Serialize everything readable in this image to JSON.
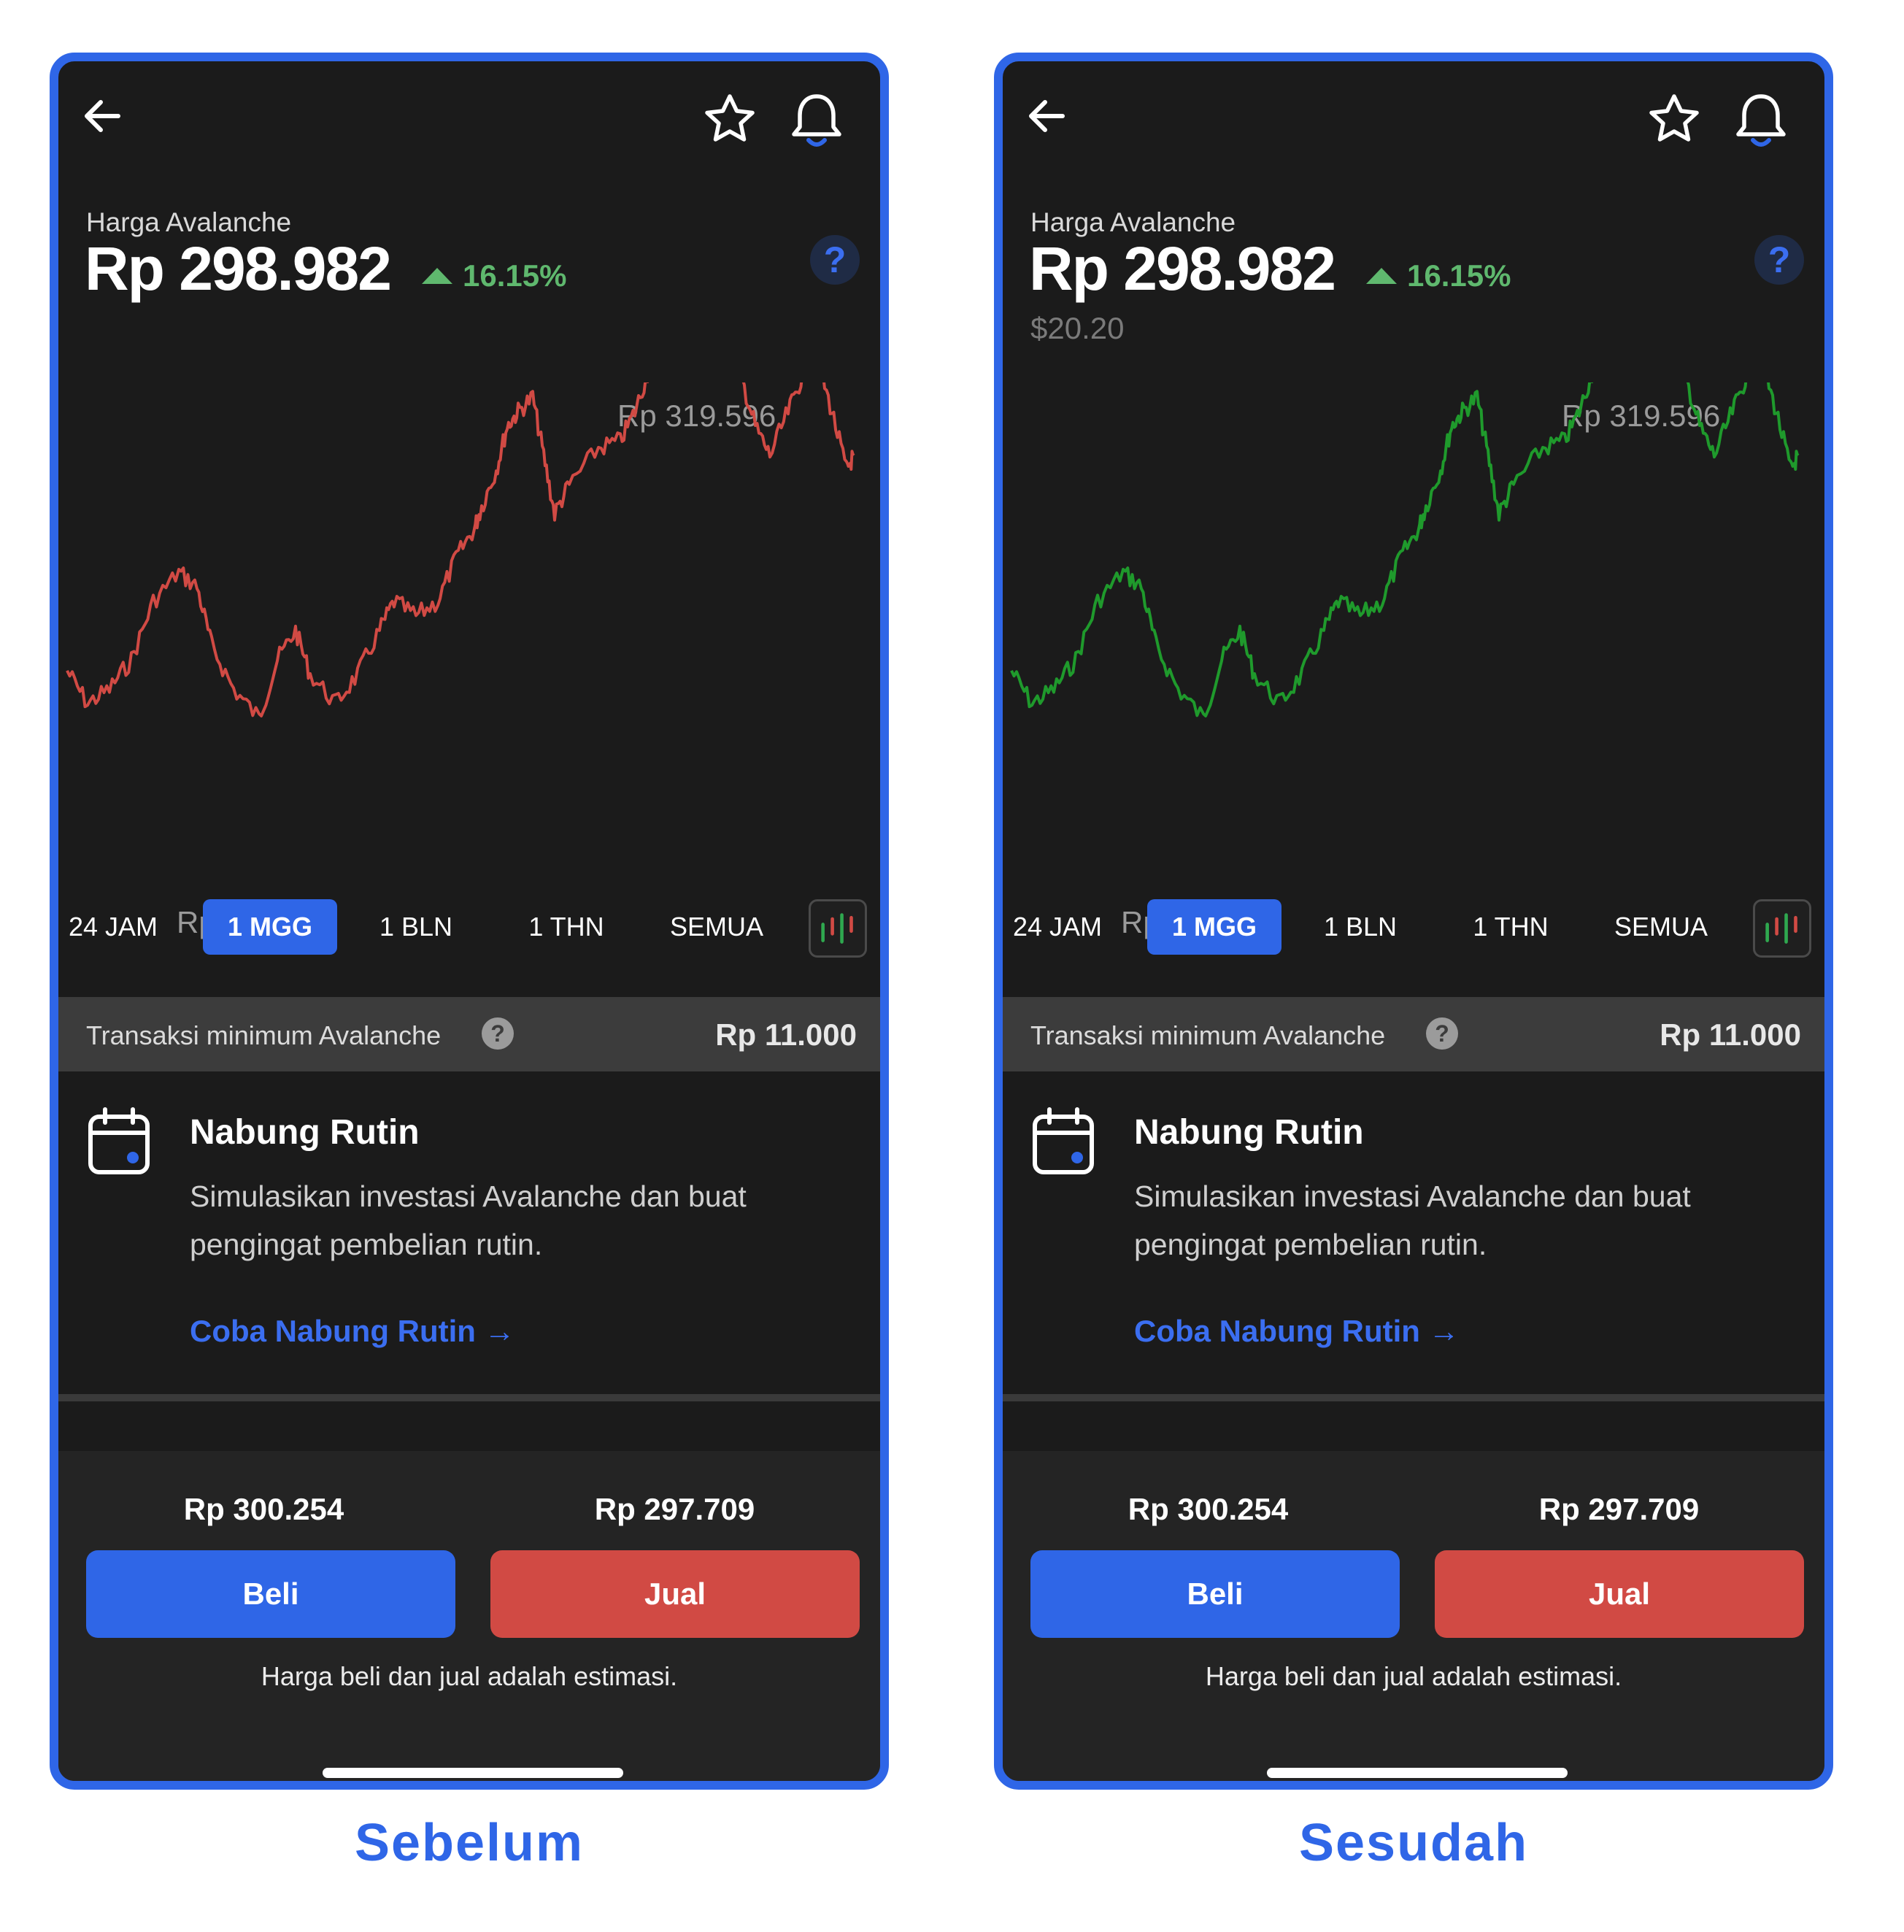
{
  "screens": [
    {
      "asset_label": "Harga Avalanche",
      "price": "Rp 298.982",
      "change": "16.15%",
      "usd_price": "",
      "help_symbol": "?",
      "chart_high": "Rp 319.596",
      "chart_low": "Rp 238.563",
      "line_color": "#d14a44",
      "tabs": [
        "24 JAM",
        "1 MGG",
        "1 BLN",
        "1 THN",
        "SEMUA"
      ],
      "active_tab": "1 MGG",
      "min_label": "Transaksi minimum Avalanche",
      "min_value": "Rp 11.000",
      "nabung_title": "Nabung Rutin",
      "nabung_desc": "Simulasikan investasi Avalanche dan buat pengingat pembelian rutin.",
      "nabung_link": "Coba Nabung Rutin →",
      "buy_price": "Rp 300.254",
      "sell_price": "Rp 297.709",
      "buy_label": "Beli",
      "sell_label": "Jual",
      "disclaimer": "Harga beli dan jual adalah estimasi.",
      "caption": "Sebelum"
    },
    {
      "asset_label": "Harga Avalanche",
      "price": "Rp 298.982",
      "change": "16.15%",
      "usd_price": "$20.20",
      "help_symbol": "?",
      "chart_high": "Rp 319.596",
      "chart_low": "Rp 238.563",
      "line_color": "#1f9a2c",
      "tabs": [
        "24 JAM",
        "1 MGG",
        "1 BLN",
        "1 THN",
        "SEMUA"
      ],
      "active_tab": "1 MGG",
      "min_label": "Transaksi minimum Avalanche",
      "min_value": "Rp 11.000",
      "nabung_title": "Nabung Rutin",
      "nabung_desc": "Simulasikan investasi Avalanche dan buat pengingat pembelian rutin.",
      "nabung_link": "Coba Nabung Rutin →",
      "buy_price": "Rp 300.254",
      "sell_price": "Rp 297.709",
      "buy_label": "Beli",
      "sell_label": "Jual",
      "disclaimer": "Harga beli dan jual adalah estimasi.",
      "caption": "Sesudah"
    }
  ],
  "colors": {
    "accent": "#2f66e7",
    "positive": "#5fb86e",
    "sell": "#d14a44",
    "background": "#1b1b1b"
  },
  "icons": [
    "back-arrow-icon",
    "star-icon",
    "bell-icon",
    "help-icon",
    "candlestick-icon",
    "calendar-icon"
  ]
}
